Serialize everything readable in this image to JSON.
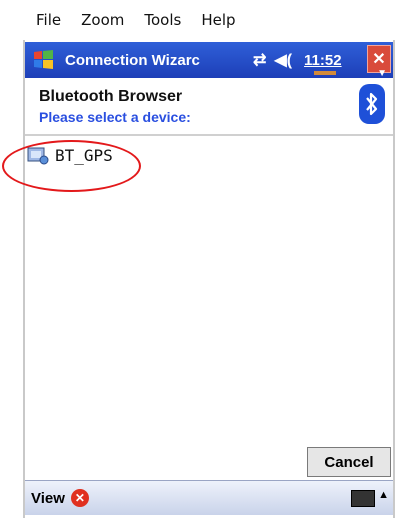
{
  "menu": {
    "items": [
      "File",
      "Zoom",
      "Tools",
      "Help"
    ]
  },
  "titlebar": {
    "title": "Connection Wizarc",
    "time": "11:52"
  },
  "header": {
    "title": "Bluetooth Browser",
    "subtitle": "Please select a device:"
  },
  "devices": [
    {
      "label": "BT_GPS"
    }
  ],
  "buttons": {
    "cancel": "Cancel"
  },
  "bottombar": {
    "view": "View"
  },
  "icons": {
    "start": "windows-flag-icon",
    "connectivity": "connectivity-arrows-icon",
    "volume": "speaker-icon",
    "close": "close-icon",
    "bluetooth": "bluetooth-icon",
    "device": "device-icon",
    "keyboard": "keyboard-icon"
  },
  "colors": {
    "titlebar": "#1d3fb8",
    "accent": "#2a4fe0",
    "highlight": "#e3191b"
  }
}
